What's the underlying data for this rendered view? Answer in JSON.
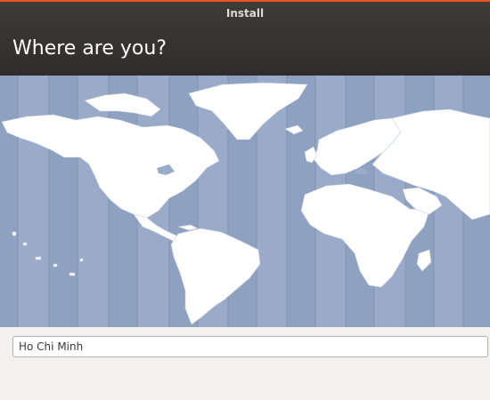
{
  "window": {
    "title": "Install",
    "accent_color": "#e95420",
    "header_color": "#3a3836"
  },
  "page": {
    "heading": "Where are you?"
  },
  "map": {
    "ocean_color": "#9aabc9",
    "land_color": "#ffffff",
    "timezone_band_color": "#8fa1c1"
  },
  "location": {
    "value": "Ho Chi Minh"
  }
}
